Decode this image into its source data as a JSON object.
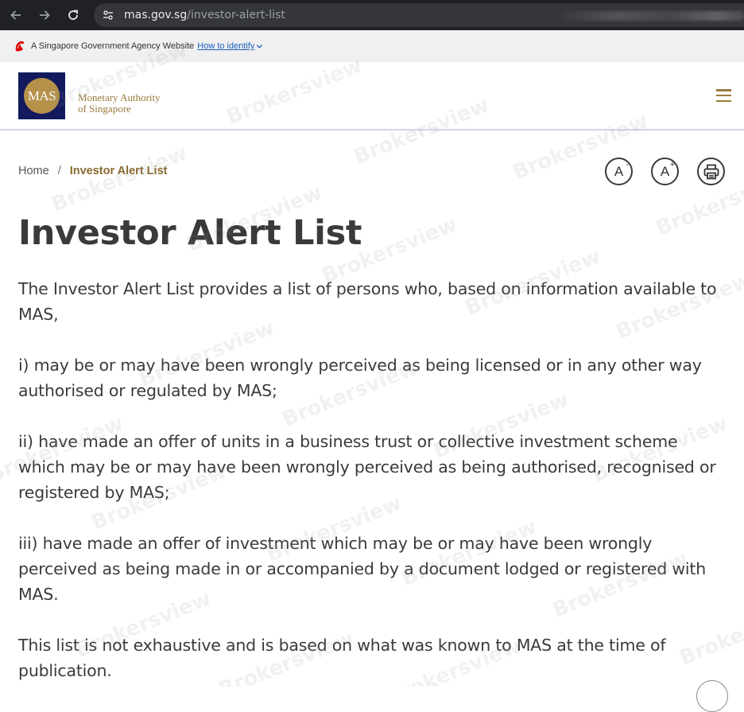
{
  "browser": {
    "url_host": "mas.gov.sg",
    "url_path": "/investor-alert-list"
  },
  "gov_banner": {
    "text": "A Singapore Government Agency Website",
    "link": "How to identify"
  },
  "header": {
    "logo_text": "MAS",
    "org_line1": "Monetary Authority",
    "org_line2": "of Singapore"
  },
  "breadcrumb": {
    "home": "Home",
    "separator": "/",
    "current": "Investor Alert List"
  },
  "tools": {
    "decrease_label": "A",
    "decrease_sign": "-",
    "increase_label": "A",
    "increase_sign": "+"
  },
  "page": {
    "title": "Investor Alert List",
    "paragraphs": [
      "The Investor Alert List provides a list of persons who, based on information available to MAS,",
      "i) may be or may have been wrongly perceived as being licensed or in any other way authorised or regulated by MAS;",
      "ii) have made an offer of units in a business trust or collective investment scheme which may be or may have been wrongly perceived as being authorised, recognised or registered by MAS;",
      "iii) have made an offer of investment which may be or may have been wrongly perceived as being made in or accompanied by a document lodged or registered with MAS.",
      "This list is not exhaustive and is based on what was known to MAS at the time of publication."
    ]
  },
  "watermark": {
    "text": "Brokersview"
  },
  "colors": {
    "brand_gold": "#9a7a3c",
    "logo_navy": "#12195c",
    "text_dark": "#3a3a3a"
  }
}
